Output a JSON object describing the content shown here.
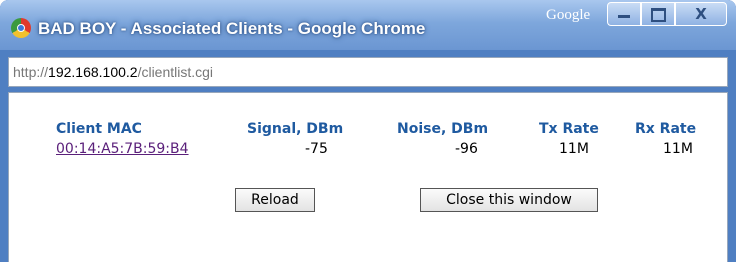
{
  "window": {
    "title": "BAD BOY - Associated Clients - Google Chrome",
    "brand": "Google",
    "minimize_icon": "minimize-icon",
    "maximize_icon": "maximize-icon",
    "close_icon": "close-icon",
    "close_glyph": "X",
    "title_color": "#ffffff",
    "frame_color": "#4f7fc2"
  },
  "address": {
    "scheme": "http://",
    "host": "192.168.100.2",
    "path": "/clientlist.cgi"
  },
  "table": {
    "headers": [
      "Client MAC",
      "Signal, DBm",
      "Noise, DBm",
      "Tx Rate",
      "Rx Rate"
    ],
    "rows": [
      [
        "00:14:A5:7B:59:B4",
        "-75",
        "-96",
        "11M",
        "11M"
      ]
    ],
    "header_color": "#1f5aa0",
    "link_color": "#5a1f7a"
  },
  "buttons": {
    "reload": "Reload",
    "close_window": "Close this window"
  }
}
